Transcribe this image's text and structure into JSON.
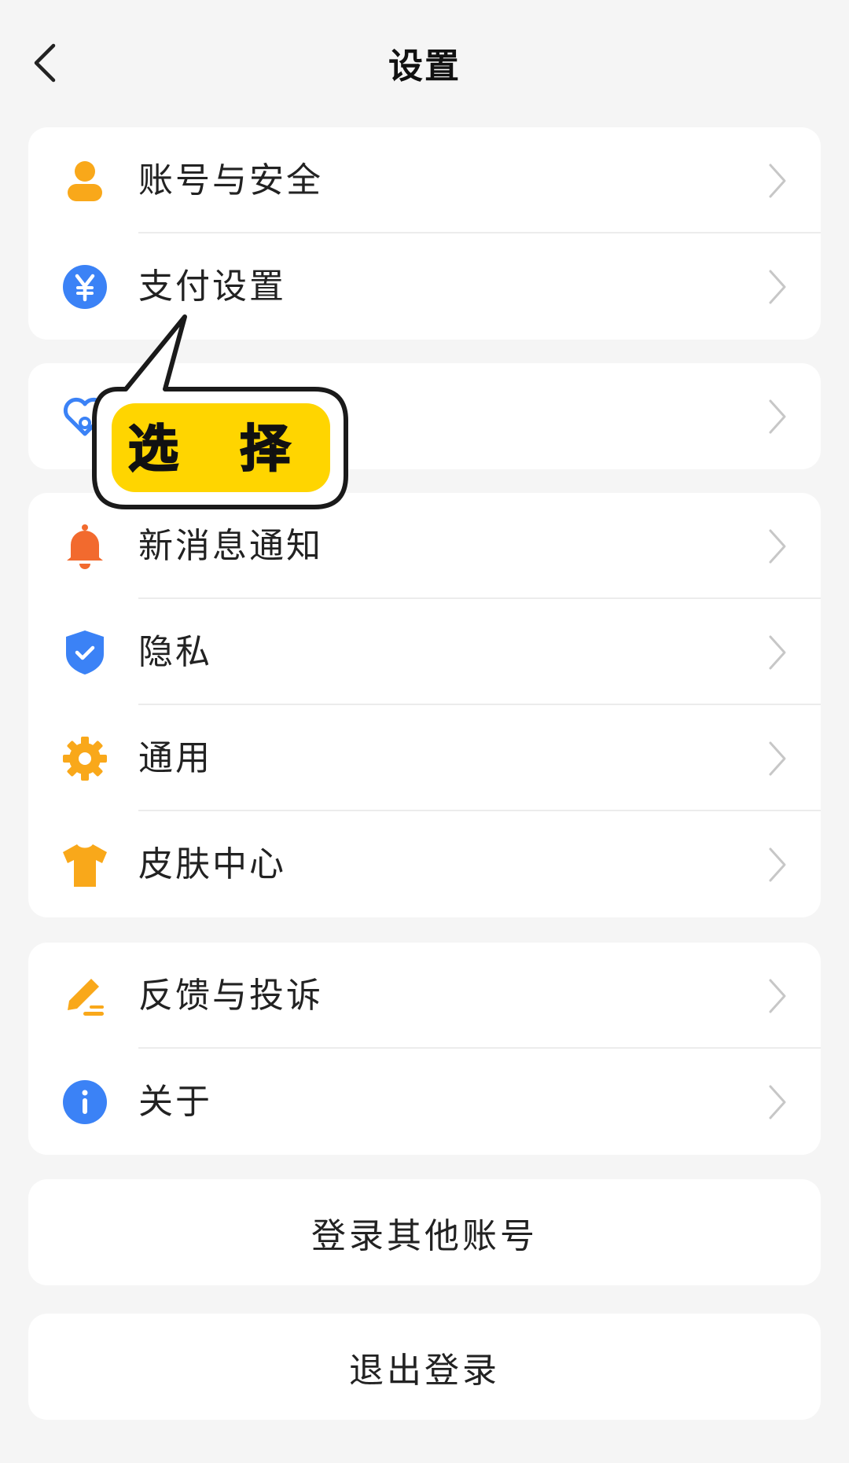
{
  "header": {
    "title": "设置",
    "back_icon": "chevron-left-icon"
  },
  "groups": [
    {
      "items": [
        {
          "label": "账号与安全",
          "icon": "user-icon",
          "color": "#f9a81a"
        },
        {
          "label": "支付设置",
          "icon": "yen-icon",
          "color": "#3b82f6"
        }
      ]
    },
    {
      "items": [
        {
          "label": "",
          "icon": "heart-link-icon",
          "color": "#3b82f6"
        }
      ]
    },
    {
      "items": [
        {
          "label": "新消息通知",
          "icon": "bell-icon",
          "color": "#f26a2e"
        },
        {
          "label": "隐私",
          "icon": "shield-check-icon",
          "color": "#3b82f6"
        },
        {
          "label": "通用",
          "icon": "gear-icon",
          "color": "#f9a81a"
        },
        {
          "label": "皮肤中心",
          "icon": "tshirt-icon",
          "color": "#f9a81a"
        }
      ]
    },
    {
      "items": [
        {
          "label": "反馈与投诉",
          "icon": "edit-pen-icon",
          "color": "#f9a81a"
        },
        {
          "label": "关于",
          "icon": "info-icon",
          "color": "#3b82f6"
        }
      ]
    }
  ],
  "buttons": {
    "switch_account": "登录其他账号",
    "logout": "退出登录"
  },
  "callout": {
    "text": "选 择",
    "fill_color": "#ffd500"
  }
}
